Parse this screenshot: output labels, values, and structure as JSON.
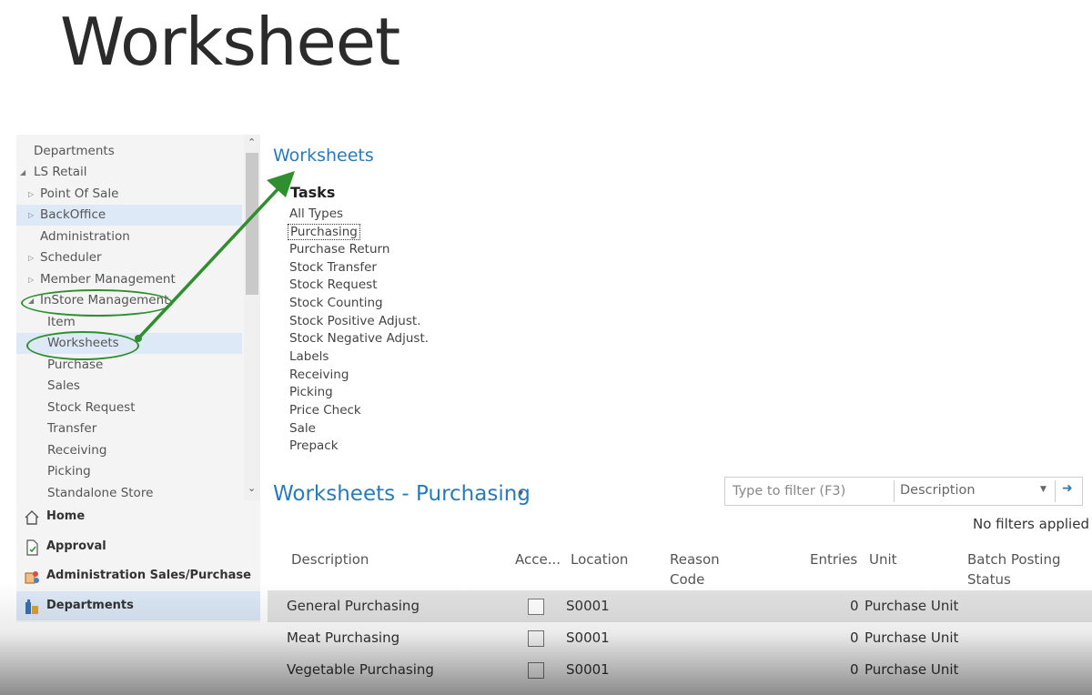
{
  "slide_title": "Worksheet",
  "navigation": {
    "tree": [
      {
        "label": "Departments",
        "level": 0,
        "expander": "none"
      },
      {
        "label": "LS Retail",
        "level": 0,
        "expander": "expanded"
      },
      {
        "label": "Point Of Sale",
        "level": 1,
        "expander": "collapsed"
      },
      {
        "label": "BackOffice",
        "level": 1,
        "expander": "collapsed",
        "highlighted": true
      },
      {
        "label": "Administration",
        "level": 1,
        "expander": "none"
      },
      {
        "label": "Scheduler",
        "level": 1,
        "expander": "collapsed"
      },
      {
        "label": "Member Management",
        "level": 1,
        "expander": "collapsed"
      },
      {
        "label": "InStore Management",
        "level": 1,
        "expander": "expanded"
      },
      {
        "label": "Item",
        "level": 2,
        "expander": "none"
      },
      {
        "label": "Worksheets",
        "level": 2,
        "expander": "none",
        "selected": true
      },
      {
        "label": "Purchase",
        "level": 2,
        "expander": "none"
      },
      {
        "label": "Sales",
        "level": 2,
        "expander": "none"
      },
      {
        "label": "Stock Request",
        "level": 2,
        "expander": "none"
      },
      {
        "label": "Transfer",
        "level": 2,
        "expander": "none"
      },
      {
        "label": "Receiving",
        "level": 2,
        "expander": "none"
      },
      {
        "label": "Picking",
        "level": 2,
        "expander": "none"
      },
      {
        "label": "Standalone Store",
        "level": 2,
        "expander": "none"
      }
    ],
    "buttons": [
      {
        "label": "Home",
        "icon": "home-icon"
      },
      {
        "label": "Approval",
        "icon": "approval-document-icon"
      },
      {
        "label": "Administration Sales/Purchase",
        "icon": "admin-people-icon"
      },
      {
        "label": "Departments",
        "icon": "departments-building-icon",
        "active": true
      }
    ]
  },
  "page": {
    "breadcrumb_link": "Worksheets",
    "tasks_heading": "Tasks",
    "tasks": [
      "All Types",
      "Purchasing",
      "Purchase Return",
      "Stock Transfer",
      "Stock Request",
      "Stock Counting",
      "Stock Positive Adjust.",
      "Stock Negative Adjust.",
      "Labels",
      "Receiving",
      "Picking",
      "Price Check",
      "Sale",
      "Prepack"
    ],
    "focused_task": "Purchasing"
  },
  "list": {
    "title": "Worksheets - Purchasing",
    "filter_placeholder": "Type to filter (F3)",
    "filter_field": "Description",
    "no_filters": "No filters applied",
    "columns": {
      "description": "Description",
      "acce": "Acce...",
      "location": "Location",
      "reason_code": "Reason Code",
      "entries": "Entries",
      "unit": "Unit",
      "batch_posting_status": "Batch Posting Status"
    },
    "rows": [
      {
        "description": "General Purchasing",
        "checked": false,
        "location": "S0001",
        "entries": "0",
        "unit": "Purchase Unit",
        "selected": true
      },
      {
        "description": "Meat Purchasing",
        "checked": false,
        "location": "S0001",
        "entries": "0",
        "unit": "Purchase Unit"
      },
      {
        "description": "Vegetable Purchasing",
        "checked": false,
        "location": "S0001",
        "entries": "0",
        "unit": "Purchase Unit"
      }
    ]
  },
  "annotation": {
    "color": "#2f8f2f",
    "circled_items": [
      "InStore Management",
      "Worksheets"
    ],
    "arrow_target": "Worksheets"
  }
}
